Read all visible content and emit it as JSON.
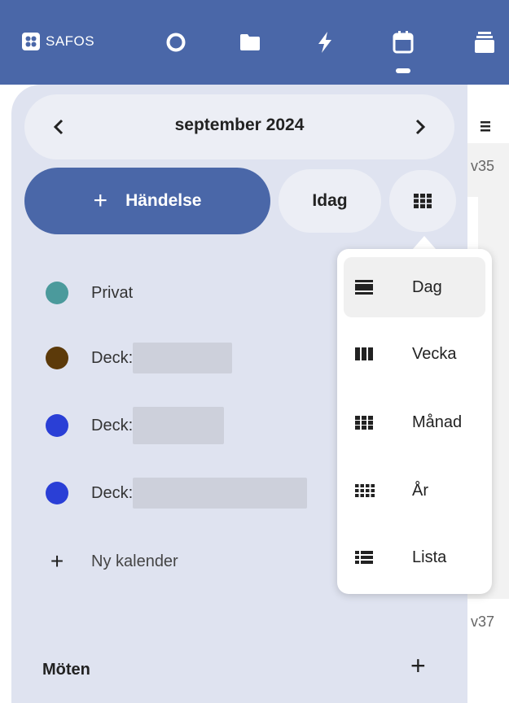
{
  "topbar": {
    "brand": "SAFOS",
    "apps": [
      "dashboard-icon",
      "files-icon",
      "activity-icon",
      "calendar-icon",
      "deck-icon"
    ],
    "active_app": "calendar-icon",
    "color": "#4a67a8"
  },
  "calendar_nav": {
    "month": "september 2024",
    "prev_icon": "chevron-left-icon",
    "next_icon": "chevron-right-icon"
  },
  "actions": {
    "new_event": "Händelse",
    "today": "Idag",
    "view_icon": "grid-view-icon"
  },
  "calendars": [
    {
      "name": "Privat",
      "color": "#4b9a9c"
    },
    {
      "name": "Deck:",
      "color": "#5c3a0a"
    },
    {
      "name": "Deck:",
      "color": "#2a3fd6"
    },
    {
      "name": "Deck:",
      "color": "#2a3fd6"
    }
  ],
  "new_calendar": "Ny kalender",
  "meetings": {
    "title": "Möten"
  },
  "view_menu": [
    {
      "label": "Dag",
      "icon": "day-view-icon",
      "active": true
    },
    {
      "label": "Vecka",
      "icon": "week-view-icon",
      "active": false
    },
    {
      "label": "Månad",
      "icon": "month-view-icon",
      "active": false
    },
    {
      "label": "År",
      "icon": "year-view-icon",
      "active": false
    },
    {
      "label": "Lista",
      "icon": "list-view-icon",
      "active": false
    }
  ],
  "right_strip": {
    "week_top": "v35",
    "week_bottom": "v37"
  }
}
